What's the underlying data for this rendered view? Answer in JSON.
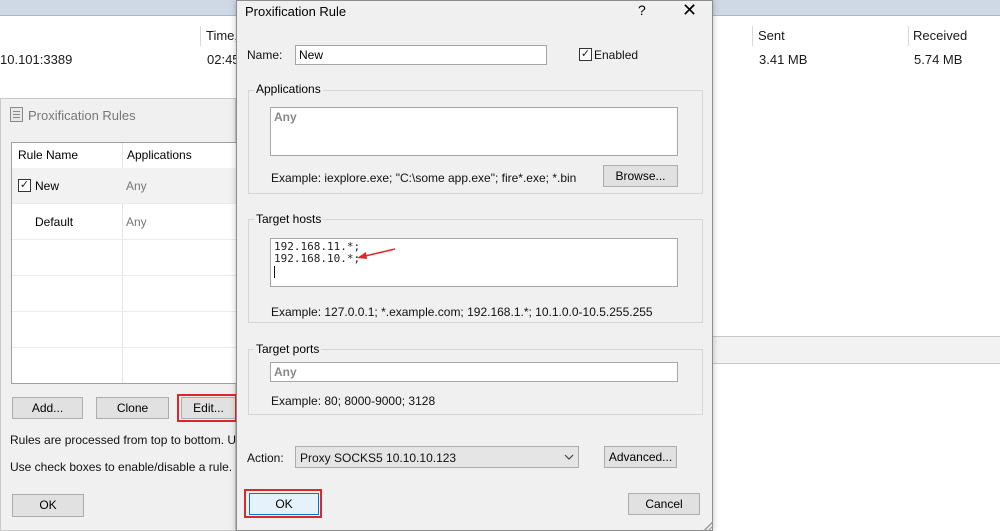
{
  "background": {
    "columns": {
      "time": "Time,",
      "sent": "Sent",
      "received": "Received"
    },
    "row": {
      "target": "10.101:3389",
      "time": "02:45",
      "sent": "3.41 MB",
      "received": "5.74 MB"
    }
  },
  "rules_window": {
    "title": "Proxification Rules",
    "columns": [
      "Rule Name",
      "Applications"
    ],
    "rules": [
      {
        "name": "New",
        "applications": "Any",
        "checked": true,
        "checkmark": "✓"
      },
      {
        "name": "Default",
        "applications": "Any",
        "checked": false
      }
    ],
    "buttons": {
      "add": "Add...",
      "clone": "Clone",
      "edit": "Edit...",
      "ok": "OK"
    },
    "notes": [
      "Rules are processed from top to bottom. Use th",
      "Use check boxes to enable/disable a rule."
    ]
  },
  "dialog": {
    "title": "Proxification Rule",
    "help_glyph": "?",
    "close_glyph": "✕",
    "name_label": "Name:",
    "name_value": "New",
    "enabled_label": "Enabled",
    "enabled_mark": "✓",
    "applications": {
      "title": "Applications",
      "value": "Any",
      "example": "Example: iexplore.exe; \"C:\\some app.exe\"; fire*.exe; *.bin",
      "browse_button": "Browse..."
    },
    "target_hosts": {
      "title": "Target hosts",
      "lines": [
        "192.168.11.*;",
        "192.168.10.*;"
      ],
      "example": "Example: 127.0.0.1; *.example.com; 192.168.1.*; 10.1.0.0-10.5.255.255"
    },
    "target_ports": {
      "title": "Target ports",
      "value": "Any",
      "example": "Example: 80; 8000-9000; 3128"
    },
    "action_label": "Action:",
    "action_value": "Proxy SOCKS5 10.10.10.123",
    "advanced_button": "Advanced...",
    "ok_button": "OK",
    "cancel_button": "Cancel"
  },
  "colors": {
    "highlight": "#e0262a",
    "arrow": "#e0262a",
    "accent_focus": "#0078d7"
  }
}
